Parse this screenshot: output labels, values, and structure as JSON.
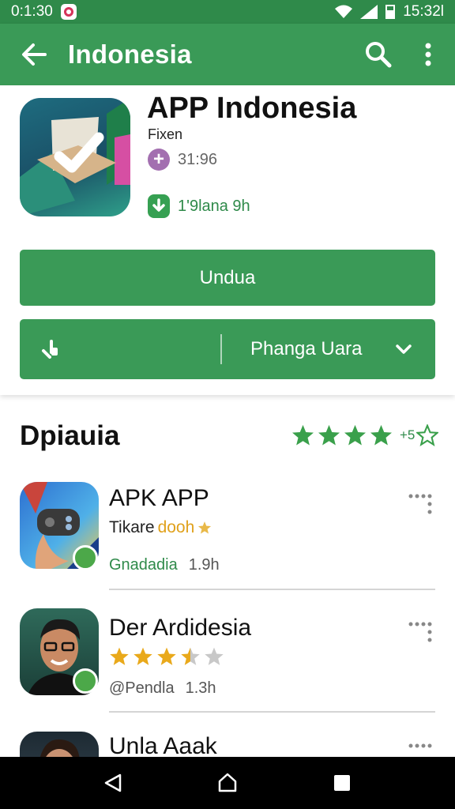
{
  "status_bar": {
    "time_left": "0:1:30",
    "time_right": "15:32l"
  },
  "app_bar": {
    "title": "Indonesia",
    "back_icon": "arrow-left-icon",
    "search_icon": "search-icon",
    "more_icon": "more-vert-icon"
  },
  "app": {
    "title": "APP Indonesia",
    "developer": "Fixen",
    "version": "31:96",
    "size": "1'9lana 9h",
    "install_label": "Undua",
    "secondary_label": "Phanga Uara",
    "colors": {
      "primary": "#3a9a57",
      "status": "#2f8a4a"
    }
  },
  "section": {
    "title": "Dpiauia",
    "rating_count": "+5",
    "stars": 4
  },
  "list": [
    {
      "name": "APK APP",
      "sub_text": "Tikare",
      "sub_highlight": "dooh",
      "publisher": "Gnadadia",
      "age": "1.9h"
    },
    {
      "name": "Der Ardidesia",
      "rating": 3.5,
      "publisher": "@Pendla",
      "age": "1.3h"
    },
    {
      "name": "Unla Aaak"
    }
  ]
}
